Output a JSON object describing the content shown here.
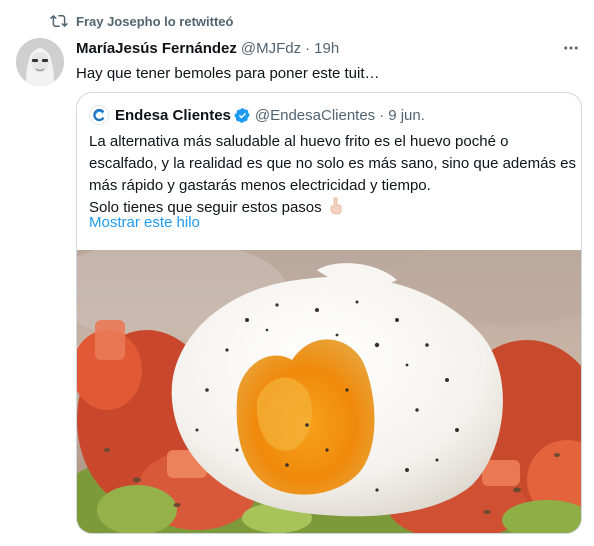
{
  "retweet": {
    "label": "Fray Josepho lo retwitteó",
    "icon": "retweet-icon"
  },
  "tweet": {
    "author_name": "MaríaJesús Fernández",
    "author_handle": "@MJFdz",
    "separator": "·",
    "timestamp": "19h",
    "text": "Hay que tener bemoles para poner este tuit…",
    "more_icon": "more-dots-icon"
  },
  "quote": {
    "author_name": "Endesa Clientes",
    "author_handle": "@EndesaClientes",
    "separator": "·",
    "date": "9 jun.",
    "verified": true,
    "lines": [
      "La alternativa más saludable al huevo frito es el huevo poché o",
      "escalfado, y la realidad es que no solo es más sano, sino que además es",
      "más rápido y gastarás menos electricidad y tiempo.",
      "Solo tienes que seguir estos pasos"
    ],
    "emoji_icon": "pointing-down-finger-icon",
    "show_thread": "Mostrar este hilo",
    "media_icon": "poached-egg-photo"
  },
  "colors": {
    "text_primary": "#0f1419",
    "text_secondary": "#536471",
    "link": "#1d9bf0",
    "border": "#cfd9de",
    "verified": "#1d9bf0"
  }
}
